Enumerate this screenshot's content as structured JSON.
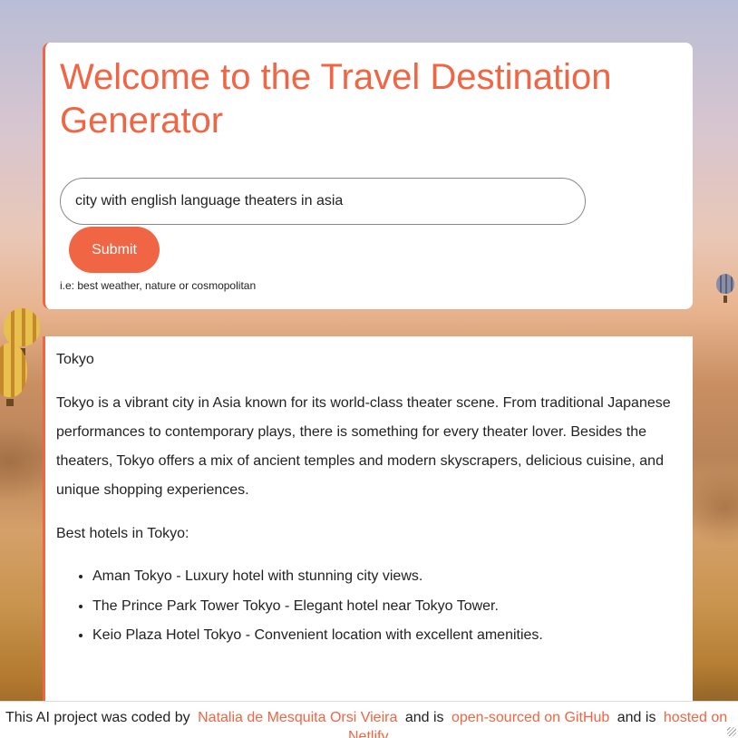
{
  "header": {
    "title": "Welcome to the Travel Destination Generator"
  },
  "form": {
    "search_value": "city with english language theaters in asia",
    "submit_label": "Submit",
    "hint": "i.e: best weather, nature or cosmopolitan"
  },
  "result": {
    "city": "Tokyo",
    "description": "Tokyo is a vibrant city in Asia known for its world-class theater scene. From traditional Japanese performances to contemporary plays, there is something for every theater lover. Besides the theaters, Tokyo offers a mix of ancient temples and modern skyscrapers, delicious cuisine, and unique shopping experiences.",
    "hotels_title": "Best hotels in Tokyo:",
    "hotels": [
      "Aman Tokyo - Luxury hotel with stunning city views.",
      "The Prince Park Tower Tokyo - Elegant hotel near Tokyo Tower.",
      "Keio Plaza Hotel Tokyo - Convenient location with excellent amenities."
    ]
  },
  "footer": {
    "text1": "This AI project was coded by",
    "author": "Natalia de Mesquita Orsi Vieira",
    "text2": "and is",
    "github": "open-sourced on GitHub",
    "text3": "and is",
    "hosted": "hosted on",
    "netlify": "Netlify"
  },
  "colors": {
    "accent": "#f06543"
  }
}
